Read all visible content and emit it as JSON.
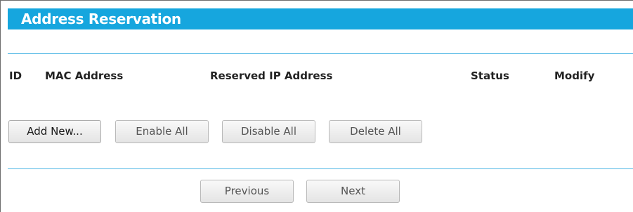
{
  "section": {
    "title": "Address Reservation"
  },
  "table": {
    "columns": [
      "ID",
      "MAC Address",
      "Reserved IP Address",
      "Status",
      "Modify"
    ],
    "rows": []
  },
  "actions": {
    "add_new": "Add New...",
    "enable_all": "Enable All",
    "disable_all": "Disable All",
    "delete_all": "Delete All"
  },
  "pagination": {
    "previous": "Previous",
    "next": "Next"
  },
  "colors": {
    "title_bar": "#16a6de",
    "divider": "#4fb7e4"
  }
}
